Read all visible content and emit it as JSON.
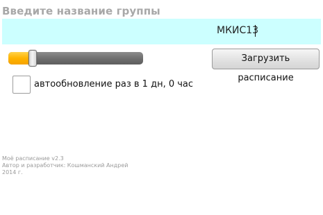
{
  "form": {
    "group_title": "Введите название группы",
    "group_input_value": "МКИС13"
  },
  "update_slider": {
    "value_fraction": 0.18,
    "fill_color": "#ffb300",
    "track_color": "#707070"
  },
  "load_button": {
    "label": "Загрузить расписание"
  },
  "auto_update": {
    "checked": false,
    "label": "автообновление раз в 1 дн, 0 час"
  },
  "about": {
    "line1": "Моё расписание v2.3",
    "line2": "Автор и разработчик: Кошманский Андрей",
    "line3": "2014 г."
  },
  "colors": {
    "input_background": "#ccffff",
    "title_color": "#a8a8a8"
  }
}
